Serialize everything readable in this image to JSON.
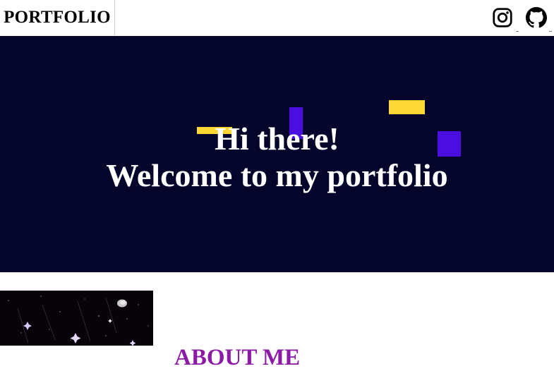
{
  "header": {
    "brand": "PORTFOLIO",
    "social": [
      {
        "name": "instagram",
        "icon": "instagram-icon"
      },
      {
        "name": "github",
        "icon": "github-icon"
      }
    ]
  },
  "hero": {
    "line1": "Hi there!",
    "line2": "Welcome to my portfolio",
    "background": "#05042b",
    "accent_yellow": "#fdd835",
    "accent_purple": "#4a0ee0"
  },
  "about": {
    "title": "ABOUT ME",
    "title_color": "#8c1aa6"
  }
}
